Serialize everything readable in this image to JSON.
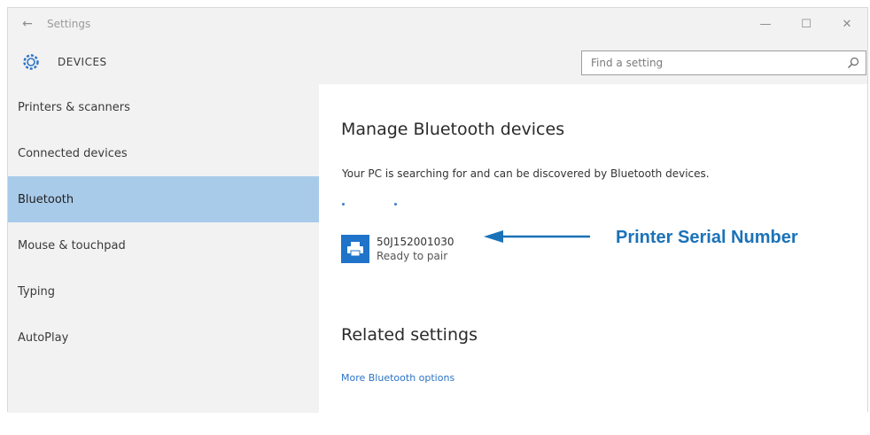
{
  "titlebar": {
    "back_glyph": "←",
    "title": "Settings",
    "minimize_glyph": "—",
    "maximize_glyph": "☐",
    "close_glyph": "✕"
  },
  "header": {
    "section_title": "DEVICES",
    "search_placeholder": "Find a setting"
  },
  "sidebar": {
    "items": [
      {
        "label": "Printers & scanners",
        "selected": false
      },
      {
        "label": "Connected devices",
        "selected": false
      },
      {
        "label": "Bluetooth",
        "selected": true
      },
      {
        "label": "Mouse & touchpad",
        "selected": false
      },
      {
        "label": "Typing",
        "selected": false
      },
      {
        "label": "AutoPlay",
        "selected": false
      }
    ]
  },
  "main": {
    "manage_heading": "Manage Bluetooth devices",
    "status_text": "Your PC is searching for and can be discovered by Bluetooth devices.",
    "device": {
      "name": "50J152001030",
      "status": "Ready to pair",
      "icon": "printer-icon"
    },
    "related_heading": "Related settings",
    "related_link": "More Bluetooth options"
  },
  "annotation": {
    "label": "Printer Serial Number"
  },
  "colors": {
    "accent": "#1f73c9",
    "selected_bg": "#a9cbea",
    "sidebar_bg": "#f2f2f2",
    "annotation": "#1b72b8",
    "link": "#2b74c6"
  }
}
